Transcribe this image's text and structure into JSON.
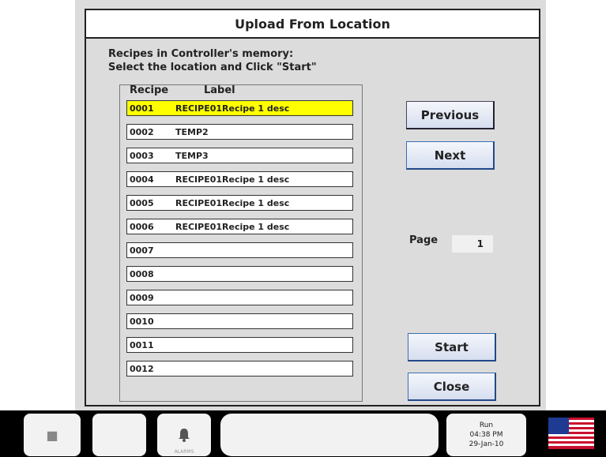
{
  "dialog": {
    "title": "Upload From Location",
    "instructions_line1": "Recipes in Controller's memory:",
    "instructions_line2": "Select the location and Click \"Start\""
  },
  "list": {
    "header_recipe": "Recipe",
    "header_label": "Label",
    "rows": [
      {
        "num": "0001",
        "label": "RECIPE01Recipe 1 desc",
        "selected": true
      },
      {
        "num": "0002",
        "label": "TEMP2"
      },
      {
        "num": "0003",
        "label": "TEMP3"
      },
      {
        "num": "0004",
        "label": "RECIPE01Recipe 1 desc"
      },
      {
        "num": "0005",
        "label": "RECIPE01Recipe 1 desc"
      },
      {
        "num": "0006",
        "label": "RECIPE01Recipe 1 desc"
      },
      {
        "num": "0007",
        "label": ""
      },
      {
        "num": "0008",
        "label": ""
      },
      {
        "num": "0009",
        "label": ""
      },
      {
        "num": "0010",
        "label": ""
      },
      {
        "num": "0011",
        "label": ""
      },
      {
        "num": "0012",
        "label": ""
      }
    ]
  },
  "buttons": {
    "previous": "Previous",
    "next": "Next",
    "start": "Start",
    "close": "Close"
  },
  "page": {
    "label": "Page",
    "value": "1"
  },
  "taskbar": {
    "status": "Run",
    "time": "04:38 PM",
    "date": "29-Jan-10",
    "alarm_sub": "ALARMS"
  },
  "colors": {
    "selected_row": "#ffff00",
    "panel_bg": "#dcdcdc",
    "button_accent": "#3b6fb5"
  }
}
